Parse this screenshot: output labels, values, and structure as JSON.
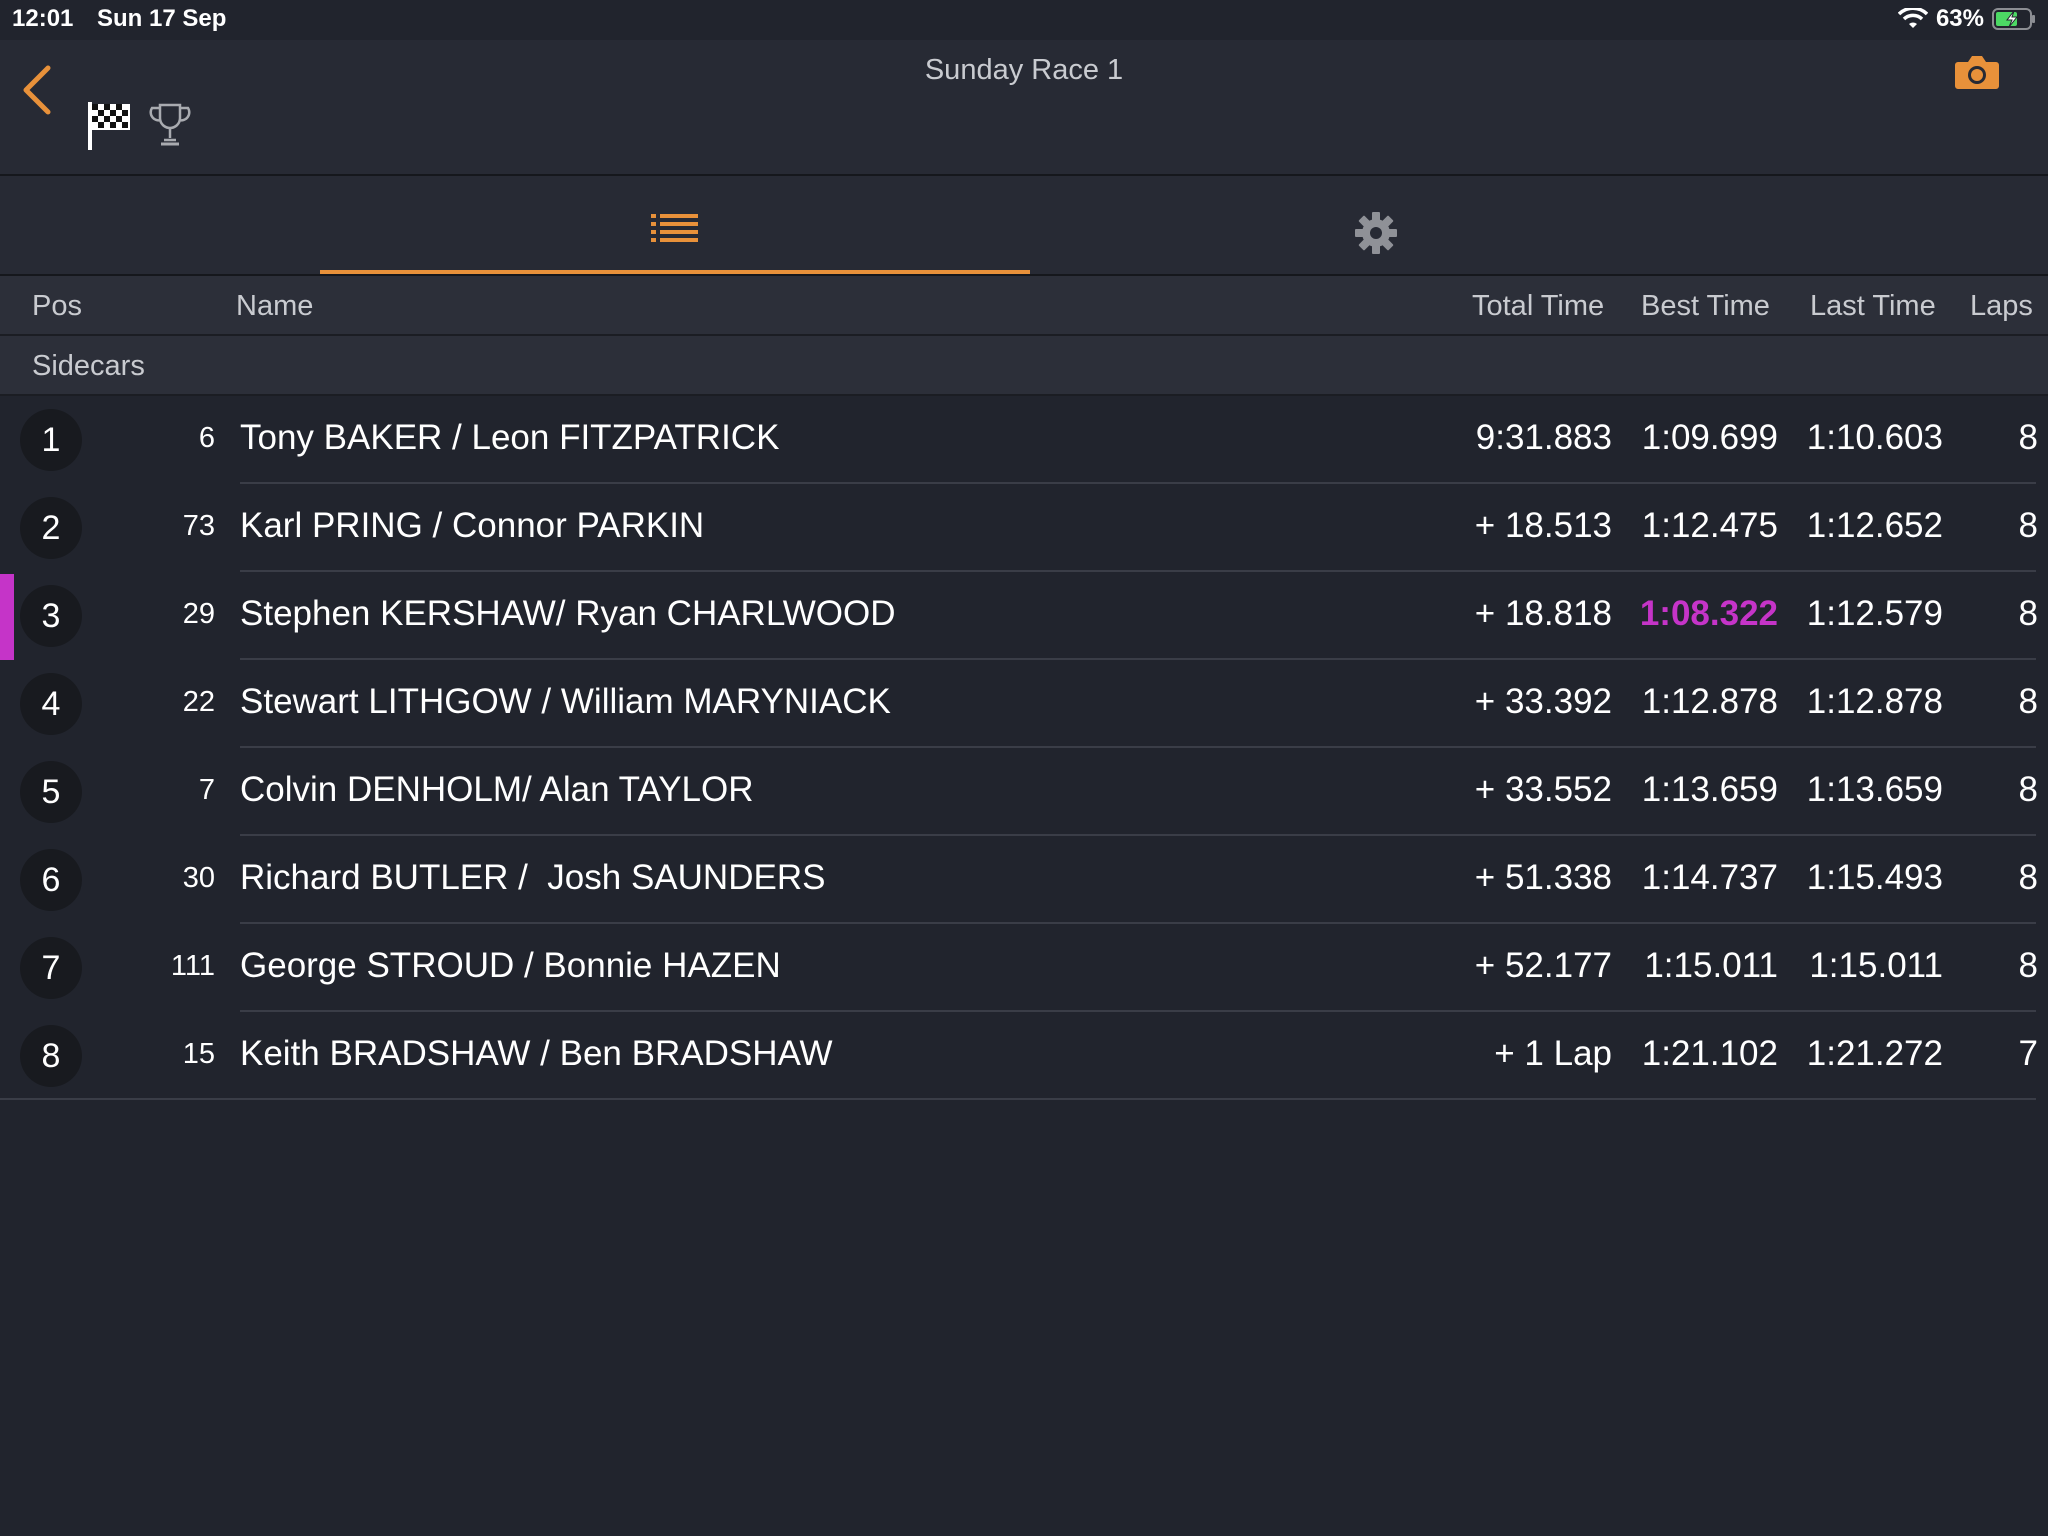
{
  "status": {
    "time": "12:01",
    "date": "Sun 17 Sep",
    "battery": "63%"
  },
  "nav": {
    "title": "Sunday Race 1"
  },
  "columns": {
    "pos": "Pos",
    "name": "Name",
    "total": "Total Time",
    "best": "Best Time",
    "last": "Last Time",
    "laps": "Laps"
  },
  "group": "Sidecars",
  "colors": {
    "accent": "#e8913a",
    "fastest": "#c534c8",
    "background": "#21242d"
  },
  "results": [
    {
      "pos": "1",
      "num": "6",
      "name": "Tony BAKER / Leon FITZPATRICK",
      "total": "9:31.883",
      "best": "1:09.699",
      "last": "1:10.603",
      "laps": "8"
    },
    {
      "pos": "2",
      "num": "73",
      "name": "Karl PRING / Connor PARKIN",
      "total": "+ 18.513",
      "best": "1:12.475",
      "last": "1:12.652",
      "laps": "8"
    },
    {
      "pos": "3",
      "num": "29",
      "name": "Stephen KERSHAW/ Ryan CHARLWOOD",
      "total": "+ 18.818",
      "best": "1:08.322",
      "last": "1:12.579",
      "laps": "8"
    },
    {
      "pos": "4",
      "num": "22",
      "name": "Stewart LITHGOW / William MARYNIACK",
      "total": "+ 33.392",
      "best": "1:12.878",
      "last": "1:12.878",
      "laps": "8"
    },
    {
      "pos": "5",
      "num": "7",
      "name": "Colvin DENHOLM/ Alan TAYLOR",
      "total": "+ 33.552",
      "best": "1:13.659",
      "last": "1:13.659",
      "laps": "8"
    },
    {
      "pos": "6",
      "num": "30",
      "name": "Richard BUTLER /  Josh SAUNDERS",
      "total": "+ 51.338",
      "best": "1:14.737",
      "last": "1:15.493",
      "laps": "8"
    },
    {
      "pos": "7",
      "num": "111",
      "name": "George STROUD / Bonnie HAZEN",
      "total": "+ 52.177",
      "best": "1:15.011",
      "last": "1:15.011",
      "laps": "8"
    },
    {
      "pos": "8",
      "num": "15",
      "name": "Keith BRADSHAW / Ben BRADSHAW",
      "total": "+ 1 Lap",
      "best": "1:21.102",
      "last": "1:21.272",
      "laps": "7"
    }
  ]
}
